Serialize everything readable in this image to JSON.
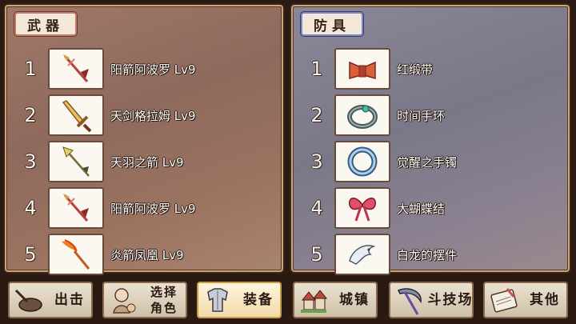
{
  "weapons": {
    "tab_label": "武器",
    "items": [
      {
        "num": "1",
        "name": "阳箭阿波罗 Lv9",
        "icon": "red-arrow-icon"
      },
      {
        "num": "2",
        "name": "天剑格拉姆 Lv9",
        "icon": "golden-sword-icon"
      },
      {
        "num": "3",
        "name": "天羽之箭 Lv9",
        "icon": "feather-arrow-icon"
      },
      {
        "num": "4",
        "name": "阳箭阿波罗 Lv9",
        "icon": "red-arrow-icon"
      },
      {
        "num": "5",
        "name": "炎箭凤凰 Lv9",
        "icon": "flame-arrow-icon"
      }
    ]
  },
  "armor": {
    "tab_label": "防具",
    "items": [
      {
        "num": "1",
        "name": "红缎带",
        "icon": "red-ribbon-icon"
      },
      {
        "num": "2",
        "name": "时间手环",
        "icon": "bracelet-icon"
      },
      {
        "num": "3",
        "name": "觉醒之手镯",
        "icon": "ring-icon"
      },
      {
        "num": "4",
        "name": "大蝴蝶结",
        "icon": "bow-icon"
      },
      {
        "num": "5",
        "name": "白龙的摆件",
        "icon": "white-dragon-icon"
      }
    ]
  },
  "menu": {
    "sortie": "出击",
    "select_character_line1": "选择",
    "select_character_line2": "角色",
    "equipment": "装备",
    "town": "城镇",
    "arena": "斗技场",
    "other": "其他",
    "active": "equipment"
  }
}
